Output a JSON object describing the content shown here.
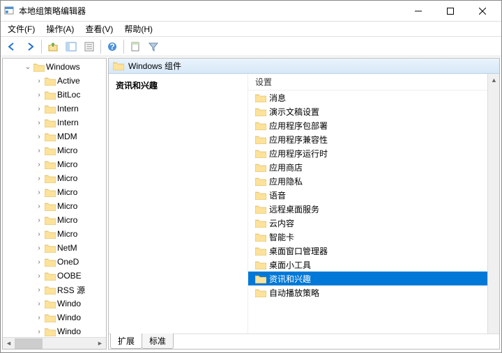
{
  "window": {
    "title": "本地组策略编辑器"
  },
  "menu": {
    "file": "文件(F)",
    "action": "操作(A)",
    "view": "查看(V)",
    "help": "帮助(H)"
  },
  "tree": {
    "root": "Windows",
    "items": [
      "Active",
      "BitLoc",
      "Intern",
      "Intern",
      "MDM",
      "Micro",
      "Micro",
      "Micro",
      "Micro",
      "Micro",
      "Micro",
      "Micro",
      "NetM",
      "OneD",
      "OOBE",
      "RSS 源",
      "Windo",
      "Windo",
      "Windo"
    ]
  },
  "right": {
    "header": "Windows 组件",
    "desc_title": "资讯和兴趣",
    "list_header": "设置",
    "items": [
      {
        "label": "消息",
        "sel": false
      },
      {
        "label": "演示文稿设置",
        "sel": false
      },
      {
        "label": "应用程序包部署",
        "sel": false
      },
      {
        "label": "应用程序兼容性",
        "sel": false
      },
      {
        "label": "应用程序运行时",
        "sel": false
      },
      {
        "label": "应用商店",
        "sel": false
      },
      {
        "label": "应用隐私",
        "sel": false
      },
      {
        "label": "语音",
        "sel": false
      },
      {
        "label": "远程桌面服务",
        "sel": false
      },
      {
        "label": "云内容",
        "sel": false
      },
      {
        "label": "智能卡",
        "sel": false
      },
      {
        "label": "桌面窗口管理器",
        "sel": false
      },
      {
        "label": "桌面小工具",
        "sel": false
      },
      {
        "label": "资讯和兴趣",
        "sel": true
      },
      {
        "label": "自动播放策略",
        "sel": false
      }
    ],
    "tabs": {
      "extended": "扩展",
      "standard": "标准"
    }
  }
}
